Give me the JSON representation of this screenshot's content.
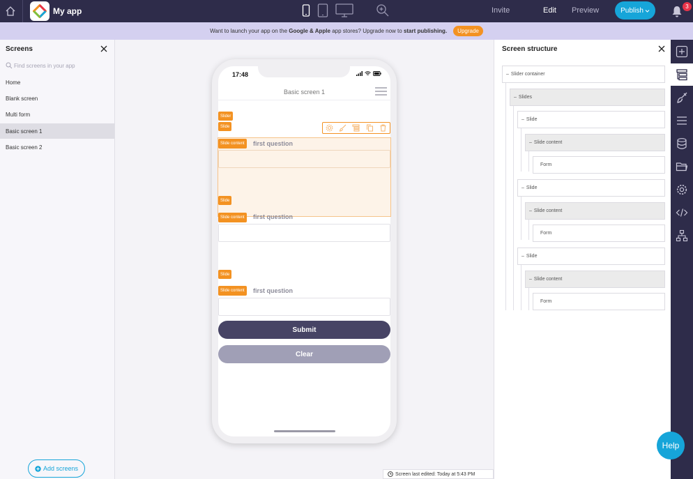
{
  "app": {
    "name": "My app"
  },
  "topbar": {
    "invite": "Invite",
    "edit": "Edit",
    "preview": "Preview",
    "publish": "Publish",
    "notification_count": "3"
  },
  "banner": {
    "text_prefix": "Want to launch your app on the",
    "text_stores": "Google & Apple",
    "text_middle": "app stores? Upgrade now to",
    "text_cta": "start publishing.",
    "upgrade": "Upgrade"
  },
  "screens_panel": {
    "title": "Screens",
    "search_placeholder": "Find screens in your app",
    "items": [
      {
        "label": "Home"
      },
      {
        "label": "Blank screen"
      },
      {
        "label": "Multi form"
      },
      {
        "label": "Basic screen 1",
        "active": true
      },
      {
        "label": "Basic screen 2"
      }
    ],
    "add_button": "Add screens"
  },
  "phone": {
    "time": "17:48",
    "screen_title": "Basic screen 1",
    "tags": {
      "slider": "Slider",
      "slide": "Slide",
      "slide_content": "Slide content"
    },
    "question": "first question",
    "submit": "Submit",
    "clear": "Clear"
  },
  "footer": {
    "last_edited": "Screen last edited: Today at 5:43 PM"
  },
  "structure_panel": {
    "title": "Screen structure",
    "nodes": [
      {
        "label": "Slider container",
        "level": 0,
        "shade": false
      },
      {
        "label": "Slides",
        "level": 1,
        "shade": true
      },
      {
        "label": "Slide",
        "level": 2,
        "shade": false
      },
      {
        "label": "Slide content",
        "level": 3,
        "shade": true
      },
      {
        "label": "Form",
        "level": 4,
        "shade": false
      },
      {
        "label": "Slide",
        "level": 2,
        "shade": false
      },
      {
        "label": "Slide content",
        "level": 3,
        "shade": true
      },
      {
        "label": "Form",
        "level": 4,
        "shade": false
      },
      {
        "label": "Slide",
        "level": 2,
        "shade": false
      },
      {
        "label": "Slide content",
        "level": 3,
        "shade": true
      },
      {
        "label": "Form",
        "level": 4,
        "shade": false
      }
    ]
  },
  "rail": {
    "icons": [
      "plus-icon",
      "layers-icon",
      "brush-icon",
      "menu-icon",
      "database-icon",
      "folder-icon",
      "gear-icon",
      "code-icon",
      "sitemap-icon"
    ],
    "active": "layers-icon"
  },
  "help": {
    "label": "Help"
  },
  "colors": {
    "topbar": "#2e2c4a",
    "accent": "#16a5d9",
    "orange": "#f39222",
    "submit": "#474465",
    "clear": "#a09fb6"
  }
}
